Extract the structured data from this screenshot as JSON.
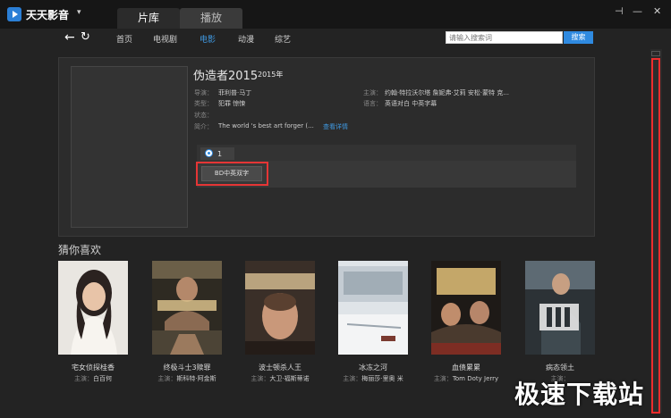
{
  "app": {
    "name": "天天影音"
  },
  "main_tabs": [
    {
      "label": "片库",
      "active": true
    },
    {
      "label": "播放",
      "active": false
    }
  ],
  "nav": {
    "items": [
      {
        "label": "首页",
        "active": false
      },
      {
        "label": "电视剧",
        "active": false
      },
      {
        "label": "电影",
        "active": true
      },
      {
        "label": "动漫",
        "active": false
      },
      {
        "label": "综艺",
        "active": false
      }
    ],
    "search_placeholder": "请输入搜索词",
    "search_button": "搜索"
  },
  "detail": {
    "title": "伪造者2015",
    "year": "2015年",
    "director_label": "导演：",
    "director": "菲利普·马丁",
    "actors_label": "主演：",
    "actors": "约翰·特拉沃尔塔 詹妮弗·艾莉 安松·蒙特 克...",
    "type_label": "类型：",
    "type": "犯罪 惊悚",
    "language_label": "语言：",
    "language": "英语对白 中英字幕",
    "status_label": "状态：",
    "status": "",
    "synopsis_label": "简介：",
    "synopsis": "The world  's best art forger (...",
    "more_link": "查看详情",
    "source_number": "1",
    "episode_label": "BD中英双字"
  },
  "recommend": {
    "heading": "猜你喜欢",
    "cast_label": "主演：",
    "items": [
      {
        "title": "宅女侦探桂香",
        "cast": "白百何"
      },
      {
        "title": "终极斗士3赎罪",
        "cast": "斯科特·阿金斯"
      },
      {
        "title": "波士顿杀人王",
        "cast": "大卫·福斯蒂诺"
      },
      {
        "title": "冰冻之河",
        "cast": "梅丽莎·里奥 米"
      },
      {
        "title": "血债累累",
        "cast": "Tom Doty Jerry"
      },
      {
        "title": "病态领土",
        "cast": ""
      }
    ]
  },
  "watermark": "极速下载站",
  "colors": {
    "accent": "#2f8ae0",
    "highlight": "#e53535",
    "background": "#232323"
  }
}
